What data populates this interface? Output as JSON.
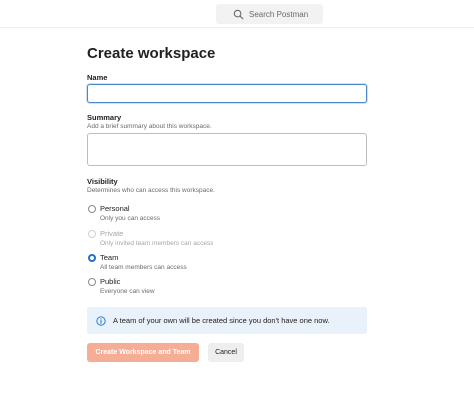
{
  "header": {
    "search_placeholder": "Search Postman",
    "search_icon": "search-icon"
  },
  "form": {
    "title": "Create workspace",
    "name": {
      "label": "Name",
      "value": ""
    },
    "summary": {
      "label": "Summary",
      "hint": "Add a brief summary about this workspace.",
      "value": ""
    },
    "visibility": {
      "label": "Visibility",
      "hint": "Determines who can access this workspace.",
      "selected": "Team",
      "options": [
        {
          "label": "Personal",
          "description": "Only you can access",
          "disabled": false,
          "checked": false
        },
        {
          "label": "Private",
          "description": "Only invited team members can access",
          "disabled": true,
          "checked": false
        },
        {
          "label": "Team",
          "description": "All team members can access",
          "disabled": false,
          "checked": true
        },
        {
          "label": "Public",
          "description": "Everyone can view",
          "disabled": false,
          "checked": false
        }
      ]
    },
    "info_banner": {
      "icon": "info-icon",
      "text": "A team of your own will be created since you don't have one now."
    },
    "buttons": {
      "create": "Create Workspace and Team",
      "cancel": "Cancel"
    }
  },
  "colors": {
    "accent": "#1f6fd1",
    "primary_button_disabled": "#f6ad96",
    "info_background": "#e9f1fb",
    "focus_border": "#4a88c8"
  }
}
